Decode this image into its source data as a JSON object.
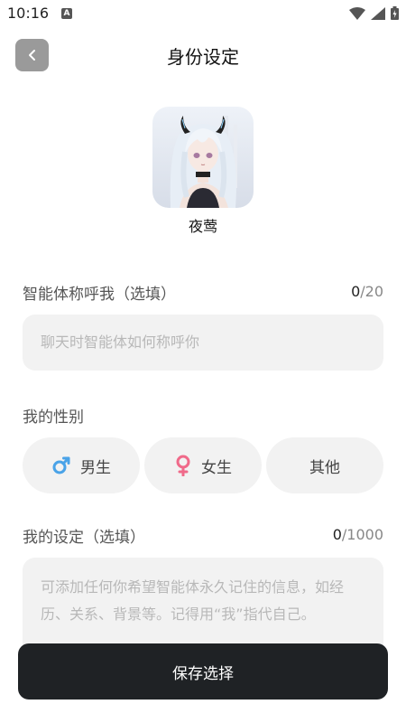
{
  "status_bar": {
    "time": "10:16",
    "notif_letter": "A"
  },
  "header": {
    "title": "身份设定"
  },
  "character": {
    "name": "夜莺"
  },
  "nickname": {
    "label": "智能体称呼我（选填）",
    "count_current": "0",
    "count_max": "/20",
    "placeholder": "聊天时智能体如何称呼你"
  },
  "gender": {
    "label": "我的性别",
    "options": [
      {
        "label": "男生",
        "icon": "male-icon",
        "color": "#4aa3e8"
      },
      {
        "label": "女生",
        "icon": "female-icon",
        "color": "#f06a8a"
      },
      {
        "label": "其他"
      }
    ]
  },
  "setting": {
    "label": "我的设定（选填）",
    "count_current": "0",
    "count_max": "/1000",
    "placeholder": "可添加任何你希望智能体永久记住的信息，如经历、关系、背景等。记得用“我”指代自己。"
  },
  "footer": {
    "save_label": "保存选择"
  }
}
